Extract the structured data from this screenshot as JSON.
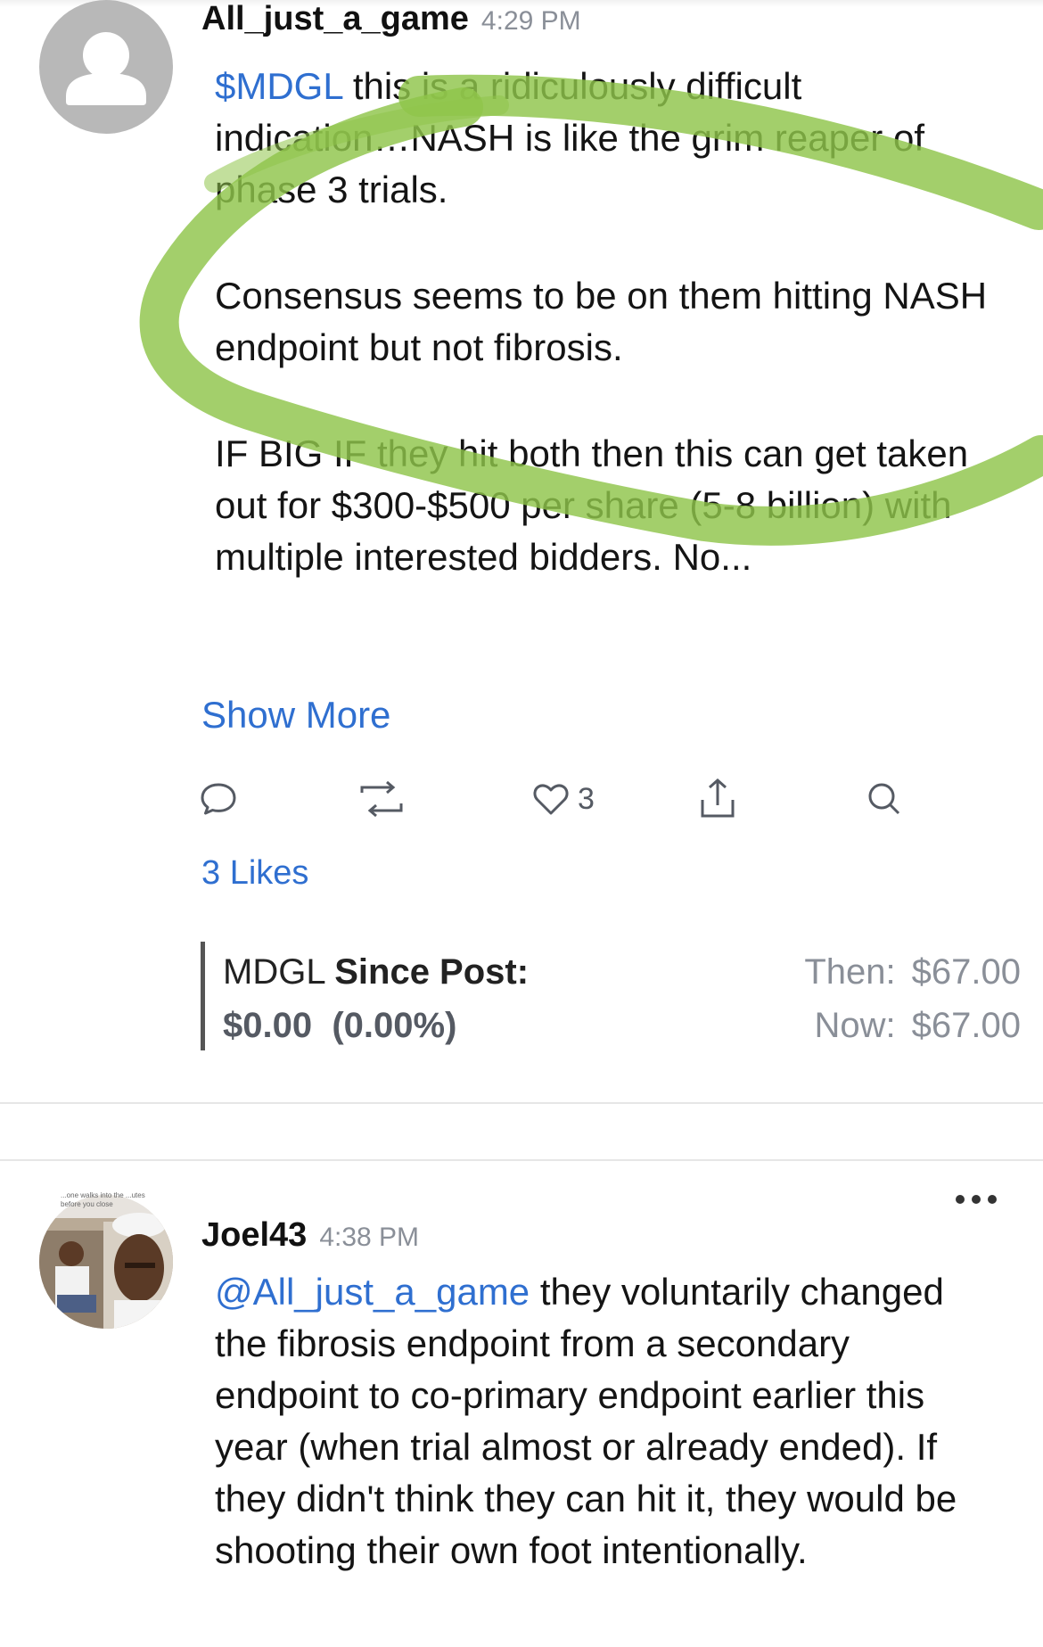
{
  "posts": [
    {
      "username": "All_just_a_game",
      "timestamp": "4:29 PM",
      "ticker_link": "$MDGL",
      "paragraphs": {
        "p1_rest": " this is a ridiculously difficult indication…NASH is like the grim reaper of phase 3 trials.",
        "p2": "Consensus seems to be on them hitting NASH endpoint but not fibrosis.",
        "p3": "IF BIG IF they hit both then this can get taken out for $300-$500 per share (5-8 billion) with multiple interested bidders. No..."
      },
      "show_more_label": "Show More",
      "actions": {
        "reply_icon": "comment-bubble-icon",
        "reshare_icon": "reshare-icon",
        "like_icon": "heart-icon",
        "like_count": "3",
        "share_icon": "share-upload-icon",
        "search_icon": "search-icon"
      },
      "likes_label": "3 Likes",
      "stock": {
        "symbol": "MDGL",
        "since_post_label": "Since Post:",
        "change": "$0.00  (0.00%)",
        "then_label": "Then:",
        "then_price": "$67.00",
        "now_label": "Now:",
        "now_price": "$67.00"
      }
    },
    {
      "username": "Joel43",
      "timestamp": "4:38 PM",
      "mention_link": "@All_just_a_game",
      "body_rest": " they voluntarily changed the fibrosis endpoint from a secondary endpoint to co-primary endpoint earlier this year (when trial almost or already ended). If they didn't think they can hit it, they would be shooting their own foot intentionally.",
      "avatar_caption": "...one walks into the ...utes before you close",
      "more_icon": "more-options-icon"
    }
  ],
  "colors": {
    "link": "#2f6fd0",
    "highlight": "#8fc44a",
    "muted": "#8a8f98"
  }
}
